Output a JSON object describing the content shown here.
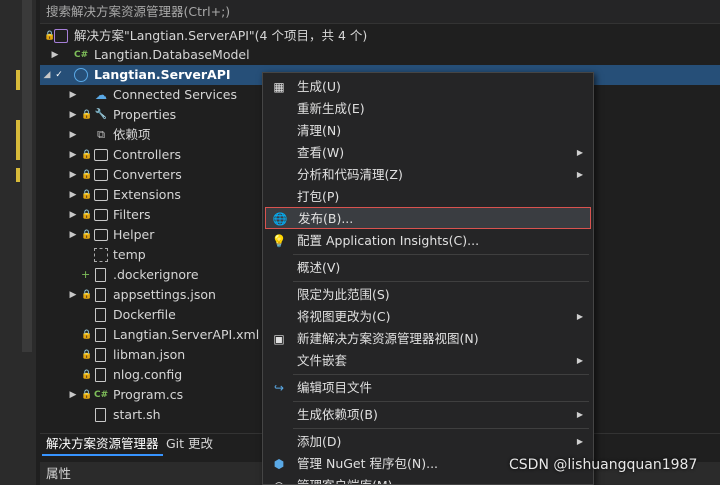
{
  "search": {
    "placeholder": "搜索解决方案资源管理器(Ctrl+;)"
  },
  "tree": {
    "solution": "解决方案\"Langtian.ServerAPI\"(4 个项目，共 4 个)",
    "database_model": "Langtian.DatabaseModel",
    "project": "Langtian.ServerAPI",
    "items": [
      "Connected Services",
      "Properties",
      "依赖项",
      "Controllers",
      "Converters",
      "Extensions",
      "Filters",
      "Helper",
      "temp",
      ".dockerignore",
      "appsettings.json",
      "Dockerfile",
      "Langtian.ServerAPI.xml",
      "libman.json",
      "nlog.config",
      "Program.cs",
      "start.sh"
    ]
  },
  "tabs": {
    "solution_explorer": "解决方案资源管理器",
    "git_changes": "Git 更改"
  },
  "properties_bar": "属性",
  "context_menu": {
    "items": [
      "生成(U)",
      "重新生成(E)",
      "清理(N)",
      "查看(W)",
      "分析和代码清理(Z)",
      "打包(P)",
      "发布(B)...",
      "配置 Application Insights(C)...",
      "概述(V)",
      "限定为此范围(S)",
      "将视图更改为(C)",
      "新建解决方案资源管理器视图(N)",
      "文件嵌套",
      "编辑项目文件",
      "生成依赖项(B)",
      "添加(D)",
      "管理 NuGet 程序包(N)...",
      "管理客户端库(M)..."
    ]
  },
  "watermark": "CSDN @lishuangquan1987",
  "colors": {
    "selection": "#264f78",
    "accent": "#3794ff",
    "highlight_border": "#d9534f"
  }
}
